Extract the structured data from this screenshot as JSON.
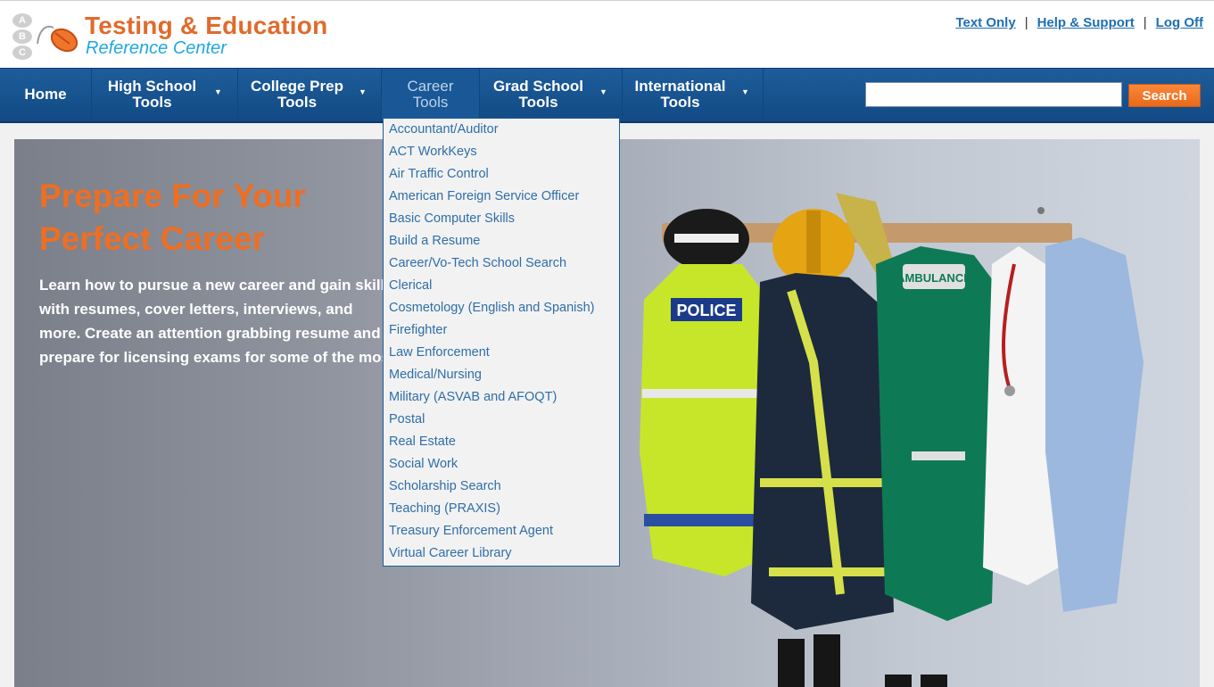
{
  "logo": {
    "title": "Testing & Education",
    "subtitle": "Reference Center",
    "circles": [
      "A",
      "B",
      "C"
    ]
  },
  "top_links": {
    "text_only": "Text Only",
    "help": "Help & Support",
    "logoff": "Log Off",
    "separator": "|"
  },
  "nav": {
    "home": "Home",
    "high_school_1": "High School",
    "high_school_2": "Tools",
    "college_prep_1": "College Prep",
    "college_prep_2": "Tools",
    "career_1": "Career",
    "career_2": "Tools",
    "grad_1": "Grad School",
    "grad_2": "Tools",
    "intl_1": "International",
    "intl_2": "Tools",
    "caret": "▼"
  },
  "search": {
    "value": "",
    "button": "Search"
  },
  "hero": {
    "title": "Prepare For Your Perfect Career",
    "text": "Learn how to pursue a new career and gain skills with resumes, cover letters, interviews, and more. Create an attention grabbing resume and prepare for licensing exams for some of the most popular careers."
  },
  "career_menu": [
    "Accountant/Auditor",
    "ACT WorkKeys",
    "Air Traffic Control",
    "American Foreign Service Officer",
    "Basic Computer Skills",
    "Build a Resume",
    "Career/Vo-Tech School Search",
    "Clerical",
    "Cosmetology (English and Spanish)",
    "Firefighter",
    "Law Enforcement",
    "Medical/Nursing",
    "Military (ASVAB and AFOQT)",
    "Postal",
    "Real Estate",
    "Social Work",
    "Scholarship Search",
    "Teaching (PRAXIS)",
    "Treasury Enforcement Agent",
    "Virtual Career Library"
  ],
  "image": {
    "police_label": "POLICE",
    "ambulance_label": "AMBULANCE"
  },
  "colors": {
    "brand_orange": "#e06b2c",
    "brand_blue": "#1ea8e0",
    "nav_blue": "#1d5d9b",
    "link_blue": "#1f6fb1",
    "search_orange": "#f07a2a"
  }
}
